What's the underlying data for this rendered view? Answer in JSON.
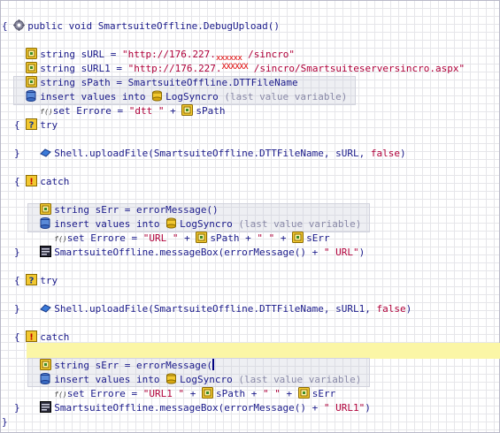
{
  "editor": {
    "header": "public void SmartsuiteOffline.DebugUpload()",
    "brace_open": "{",
    "brace_close": "}",
    "sURL_decl": "string sURL = ",
    "sURL_val_a": "\"http://176.227.",
    "sURL_mask": "xxxxxx",
    "sURL_val_b": " /sincro\"",
    "sURL1_decl": "string sURL1 = ",
    "sURL1_val_a": "\"http://176.227.",
    "sURL1_mask": "XXXXXX",
    "sURL1_val_b": " /sincro/Smartsuiteserversincro.aspx\"",
    "sPath_decl": "string sPath = SmartsuiteOffline.DTTFileName",
    "insert_text": "insert values into ",
    "table_name": "LogSyncro",
    "last_value_comment": "(last value variable)",
    "fx_label": "f()",
    "set_errore_1a": "set Errore = ",
    "set_errore_1b": "\"dtt \"",
    "plus": " + ",
    "sPath_name": "sPath",
    "try_label": "try",
    "catch_label": "catch",
    "upload_1a": "Shell.uploadFile(SmartsuiteOffline.DTTFileName, sURL, ",
    "upload_2a": "Shell.uploadFile(SmartsuiteOffline.DTTFileName, sURL1, ",
    "false_kw": "false",
    "close_paren": ")",
    "sErr_decl": "string sErr = errorMessage()",
    "sErr_decl_b_prefix": "string sErr = errorMessage(",
    "set_errore_2a": "set Errore = ",
    "str_url": "\"URL \"",
    "str_url1": "\"URL1 \"",
    "str_space": "\" \"",
    "sErr_name": "sErr",
    "msgbox_prefix": "SmartsuiteOffline.messageBox(errorMessage() + ",
    "msg_url": "\" URL\"",
    "msg_url1": "\" URL1\"",
    "msg_suffix": ")"
  },
  "icons": {
    "gear": "gear-icon",
    "variable": "variable-icon",
    "database": "database-insert-icon",
    "function": "function-icon",
    "try": "try-block-icon",
    "catch": "catch-block-icon",
    "shell": "shell-icon",
    "messagebox": "messagebox-icon"
  },
  "colors": {
    "keyword": "#1a1a8a",
    "string": "#b0003a",
    "comment": "#8a8aa8",
    "mask": "#e00000",
    "highlight": "#fbf6a6"
  }
}
